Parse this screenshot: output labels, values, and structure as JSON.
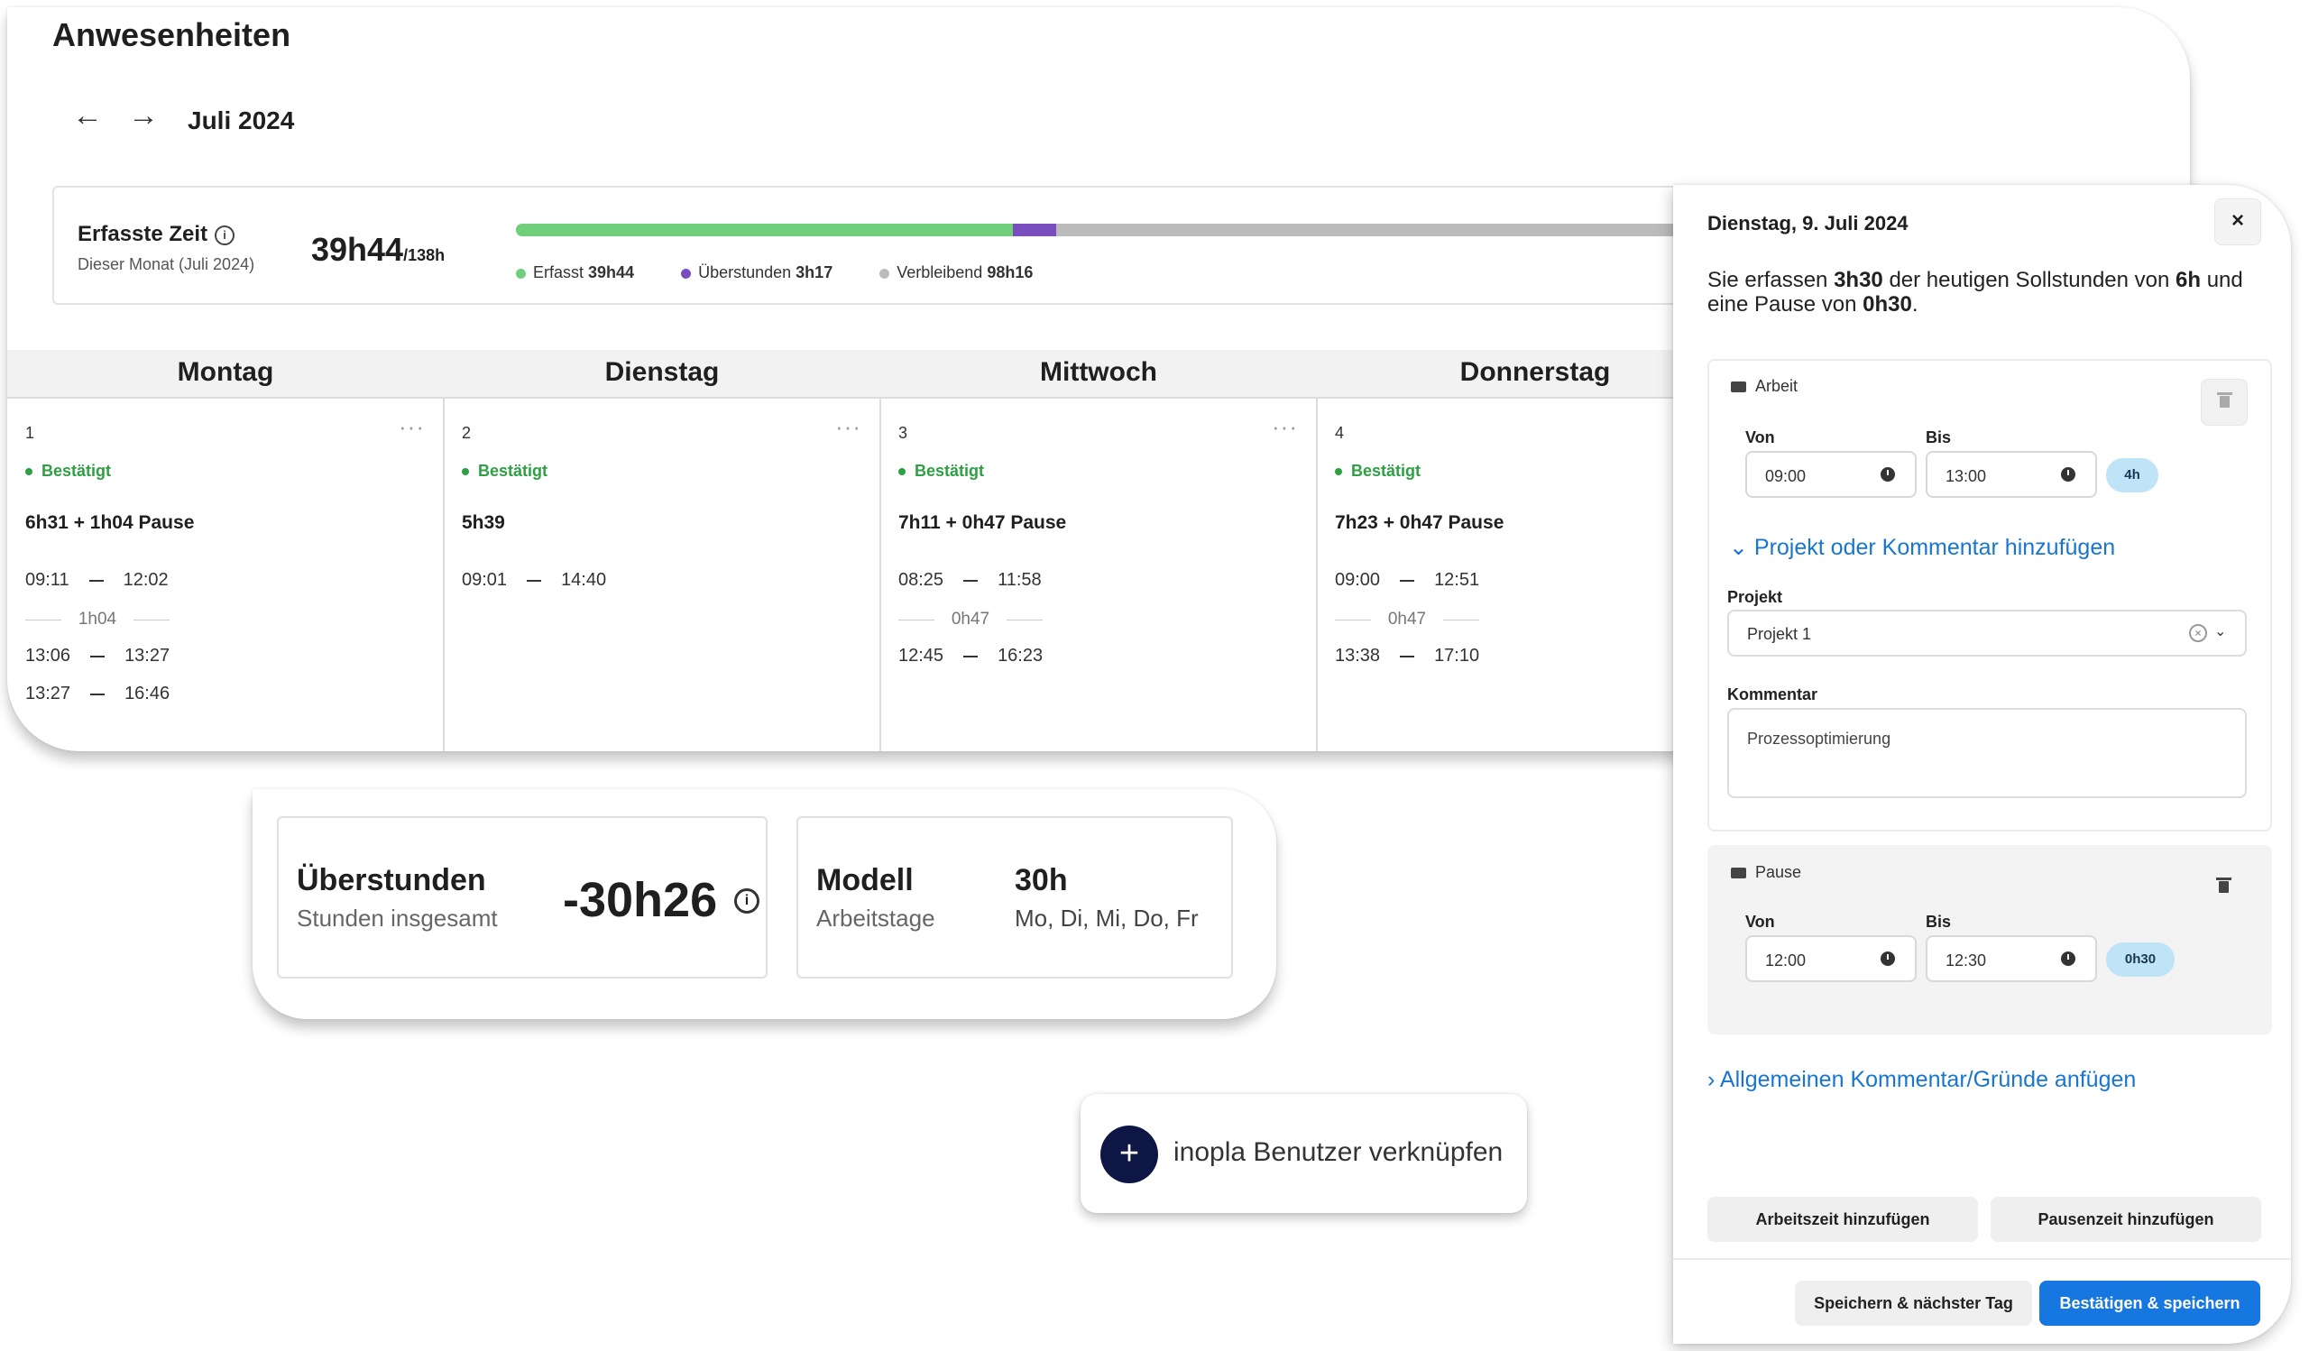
{
  "page": {
    "title": "Anwesenheiten",
    "month": "Juli 2024"
  },
  "nav": {
    "prev_icon": "←",
    "next_icon": "→"
  },
  "stats": {
    "label": "Erfasste Zeit",
    "sub": "Dieser Monat (Juli 2024)",
    "total": "39h44",
    "target": "/138h",
    "legend": [
      {
        "label": "Erfasst",
        "value": "39h44",
        "color": "#6fcf7a"
      },
      {
        "label": "Überstunden",
        "value": "3h17",
        "color": "#7a4dbf"
      },
      {
        "label": "Verbleibend",
        "value": "98h16",
        "color": "#bbbbbb"
      }
    ]
  },
  "days": [
    {
      "name": "Montag",
      "num": "1",
      "status": "Bestätigt",
      "summary": "6h31 + 1h04 Pause",
      "entries": [
        {
          "from": "09:11",
          "to": "12:02"
        },
        {
          "pause": "1h04"
        },
        {
          "from": "13:06",
          "to": "13:27"
        },
        {
          "from": "13:27",
          "to": "16:46"
        }
      ]
    },
    {
      "name": "Dienstag",
      "num": "2",
      "status": "Bestätigt",
      "summary": "5h39",
      "entries": [
        {
          "from": "09:01",
          "to": "14:40"
        }
      ]
    },
    {
      "name": "Mittwoch",
      "num": "3",
      "status": "Bestätigt",
      "summary": "7h11 + 0h47 Pause",
      "entries": [
        {
          "from": "08:25",
          "to": "11:58"
        },
        {
          "pause": "0h47"
        },
        {
          "from": "12:45",
          "to": "16:23"
        }
      ]
    },
    {
      "name": "Donnerstag",
      "num": "4",
      "status": "Bestätigt",
      "summary": "7h23 + 0h47 Pause",
      "entries": [
        {
          "from": "09:00",
          "to": "12:51"
        },
        {
          "pause": "0h47"
        },
        {
          "from": "13:38",
          "to": "17:10"
        }
      ]
    }
  ],
  "overtime": {
    "title": "Überstunden",
    "sub": "Stunden insgesamt",
    "value": "-30h26",
    "model_title": "Modell",
    "model_sub": "Arbeitstage",
    "model_value": "30h",
    "model_days": "Mo, Di, Mi, Do, Fr"
  },
  "link_button": {
    "label": "inopla Benutzer verknüpfen"
  },
  "panel": {
    "date": "Dienstag, 9. Juli 2024",
    "info_pre": "Sie erfassen ",
    "info_b1": "3h30",
    "info_mid": " der heutigen Sollstunden von ",
    "info_b2": "6h",
    "info_mid2": " und eine Pause von ",
    "info_b3": "0h30",
    "info_end": ".",
    "work": {
      "title": "Arbeit",
      "from_label": "Von",
      "to_label": "Bis",
      "from": "09:00",
      "to": "13:00",
      "duration": "4h",
      "toggle": "Projekt oder Kommentar hinzufügen",
      "project_label": "Projekt",
      "project_value": "Projekt 1",
      "comment_label": "Kommentar",
      "comment_value": "Prozessoptimierung"
    },
    "pause": {
      "title": "Pause",
      "from_label": "Von",
      "to_label": "Bis",
      "from": "12:00",
      "to": "12:30",
      "duration": "0h30"
    },
    "general_link": "Allgemeinen Kommentar/Gründe anfügen",
    "add_work": "Arbeitszeit hinzufügen",
    "add_pause": "Pausenzeit hinzufügen",
    "save_next": "Speichern & nächster Tag",
    "confirm_save": "Bestätigen & speichern",
    "close_icon": "×"
  }
}
